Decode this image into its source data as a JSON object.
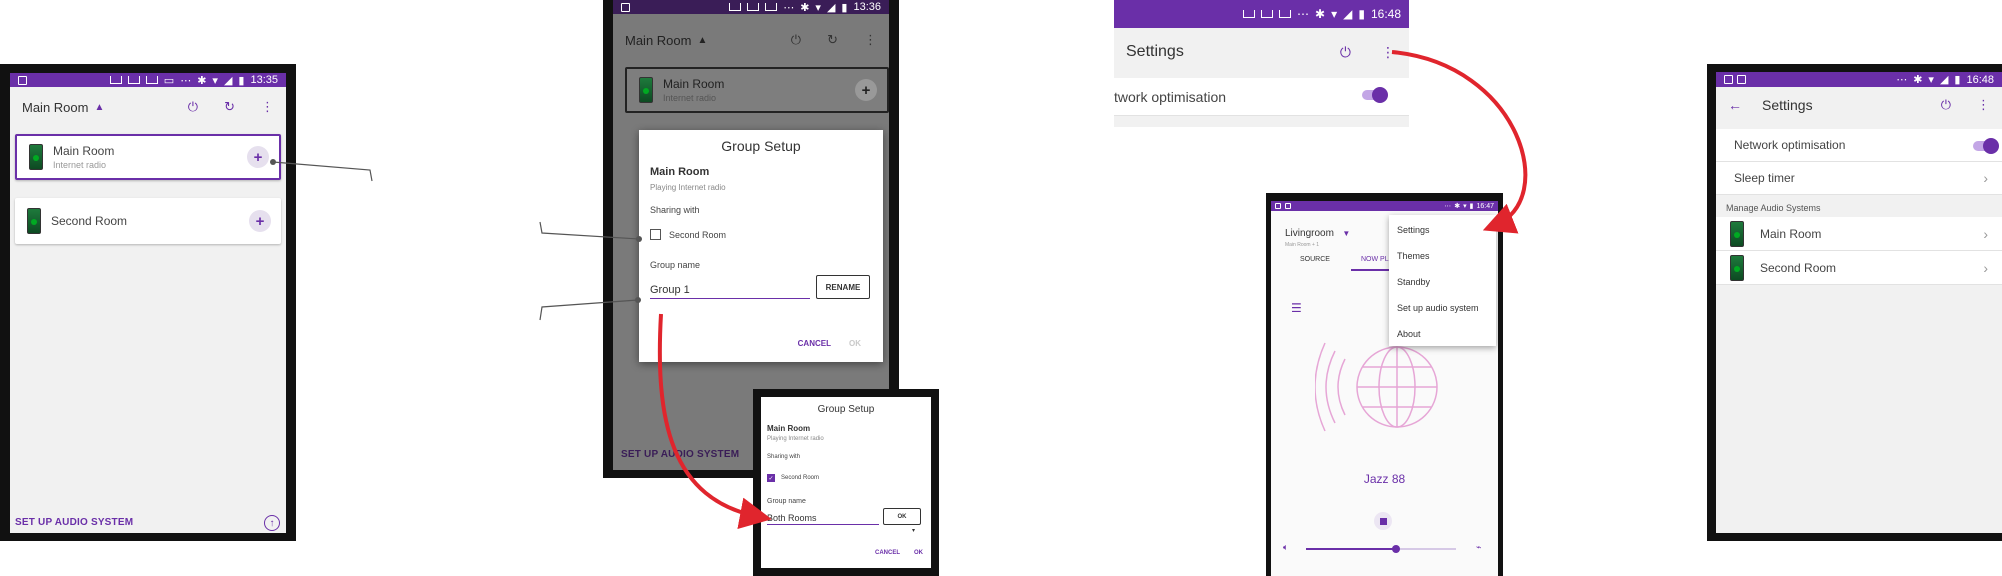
{
  "colors": {
    "accent": "#6a2fa8",
    "arrow": "#e0252d"
  },
  "phone1": {
    "time": "13:35",
    "title": "Main Room",
    "rooms": [
      {
        "name": "Main Room",
        "sub": "Internet radio"
      },
      {
        "name": "Second Room",
        "sub": ""
      }
    ],
    "footer": "SET UP AUDIO SYSTEM"
  },
  "phone2": {
    "time": "13:36",
    "title": "Main Room",
    "room": {
      "name": "Main Room",
      "sub": "Internet radio"
    },
    "footer": "SET UP AUDIO SYSTEM",
    "dialog": {
      "title": "Group Setup",
      "room": "Main Room",
      "status": "Playing Internet radio",
      "sharing_label": "Sharing with",
      "share_option": "Second Room",
      "group_label": "Group name",
      "group_value": "Group 1",
      "rename": "RENAME",
      "cancel": "CANCEL",
      "ok": "OK"
    }
  },
  "dialog2": {
    "title": "Group Setup",
    "room": "Main Room",
    "status": "Playing Internet radio",
    "sharing_label": "Sharing with",
    "share_option": "Second Room",
    "check_mark": "✓",
    "group_label": "Group name",
    "group_value": "Both Rooms",
    "ok_btn": "OK",
    "cancel": "CANCEL",
    "ok": "OK"
  },
  "phone3": {
    "time": "16:48",
    "title": "Settings",
    "row": "twork optimisation"
  },
  "phone4": {
    "time": "16:47",
    "room": "Livingroom",
    "room_sub": "Main Room + 1",
    "tab_source": "SOURCE",
    "tab_now": "NOW PL",
    "station": "Jazz 88",
    "menu": [
      "Settings",
      "Themes",
      "Standby",
      "Set up audio system",
      "About"
    ]
  },
  "phone5": {
    "time": "16:48",
    "title": "Settings",
    "network": "Network optimisation",
    "sleep": "Sleep timer",
    "section": "Manage Audio Systems",
    "systems": [
      "Main Room",
      "Second Room"
    ]
  }
}
